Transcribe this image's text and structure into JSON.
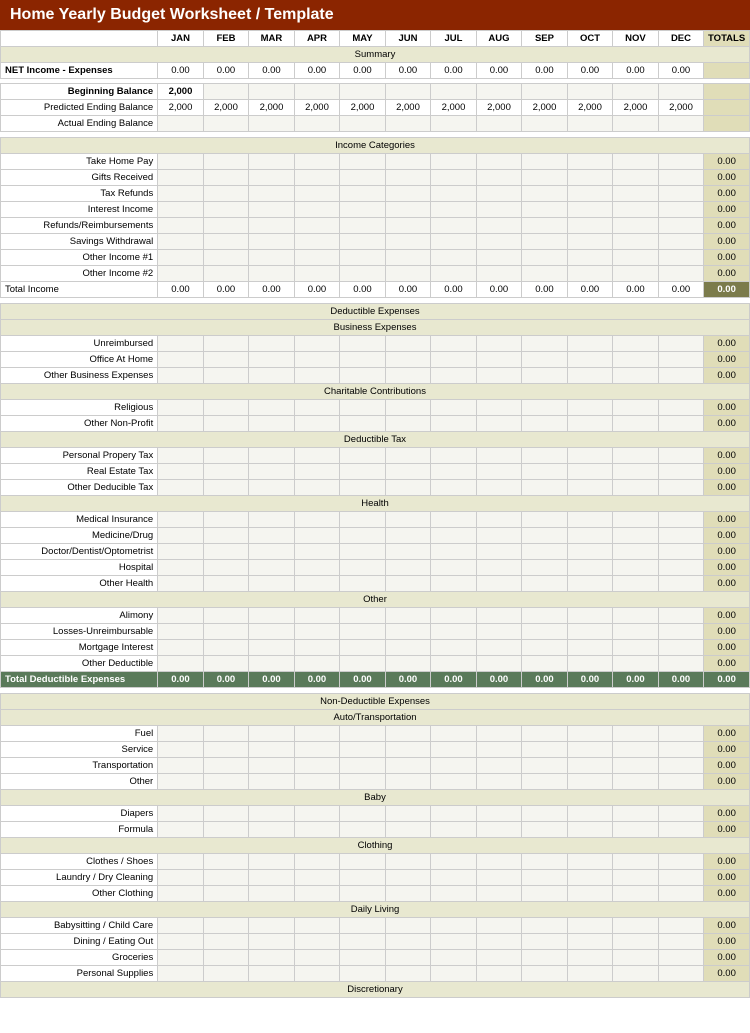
{
  "title": "Home Yearly Budget Worksheet / Template",
  "months": [
    "JAN",
    "FEB",
    "MAR",
    "APR",
    "MAY",
    "JUN",
    "JUL",
    "AUG",
    "SEP",
    "OCT",
    "NOV",
    "DEC"
  ],
  "totals_label": "TOTALS",
  "summary": {
    "label": "Summary",
    "net_income_label": "NET Income - Expenses",
    "beginning_balance_label": "Beginning Balance",
    "beginning_balance_value": "2,000",
    "predicted_label": "Predicted Ending Balance",
    "actual_label": "Actual Ending Balance",
    "net_values": [
      "0.00",
      "0.00",
      "0.00",
      "0.00",
      "0.00",
      "0.00",
      "0.00",
      "0.00",
      "0.00",
      "0.00",
      "0.00",
      "0.00"
    ],
    "predicted_values": [
      "2,000",
      "2,000",
      "2,000",
      "2,000",
      "2,000",
      "2,000",
      "2,000",
      "2,000",
      "2,000",
      "2,000",
      "2,000",
      "2,000"
    ],
    "actual_values": [
      "",
      "",
      "",
      "",
      "",
      "",
      "",
      "",
      "",
      "",
      "",
      ""
    ]
  },
  "income": {
    "section_label": "Income Categories",
    "items": [
      "Take Home Pay",
      "Gifts Received",
      "Tax Refunds",
      "Interest Income",
      "Refunds/Reimbursements",
      "Savings Withdrawal",
      "Other Income #1",
      "Other Income #2"
    ],
    "total_label": "Total Income",
    "total_values": [
      "0.00",
      "0.00",
      "0.00",
      "0.00",
      "0.00",
      "0.00",
      "0.00",
      "0.00",
      "0.00",
      "0.00",
      "0.00",
      "0.00"
    ],
    "total_totals": "0.00"
  },
  "deductible": {
    "section_label": "Deductible Expenses",
    "groups": [
      {
        "name": "Business Expenses",
        "items": [
          "Unreimbursed",
          "Office At Home",
          "Other Business Expenses"
        ]
      },
      {
        "name": "Charitable Contributions",
        "items": [
          "Religious",
          "Other Non-Profit"
        ]
      },
      {
        "name": "Deductible Tax",
        "items": [
          "Personal Propery Tax",
          "Real Estate Tax",
          "Other Deducible Tax"
        ]
      },
      {
        "name": "Health",
        "items": [
          "Medical Insurance",
          "Medicine/Drug",
          "Doctor/Dentist/Optometrist",
          "Hospital",
          "Other Health"
        ]
      },
      {
        "name": "Other",
        "items": [
          "Alimony",
          "Losses-Unreimbursable",
          "Mortgage Interest",
          "Other Deductible"
        ]
      }
    ],
    "total_label": "Total Deductible Expenses",
    "total_values": [
      "0.00",
      "0.00",
      "0.00",
      "0.00",
      "0.00",
      "0.00",
      "0.00",
      "0.00",
      "0.00",
      "0.00",
      "0.00",
      "0.00"
    ],
    "total_totals": "0.00"
  },
  "non_deductible": {
    "section_label": "Non-Deductible Expenses",
    "groups": [
      {
        "name": "Auto/Transportation",
        "items": [
          "Fuel",
          "Service",
          "Transportation",
          "Other"
        ]
      },
      {
        "name": "Baby",
        "items": [
          "Diapers",
          "Formula"
        ]
      },
      {
        "name": "Clothing",
        "items": [
          "Clothes / Shoes",
          "Laundry / Dry Cleaning",
          "Other Clothing"
        ]
      },
      {
        "name": "Daily Living",
        "items": [
          "Babysitting / Child Care",
          "Dining / Eating Out",
          "Groceries",
          "Personal Supplies"
        ]
      },
      {
        "name": "Discretionary",
        "items": []
      }
    ]
  }
}
